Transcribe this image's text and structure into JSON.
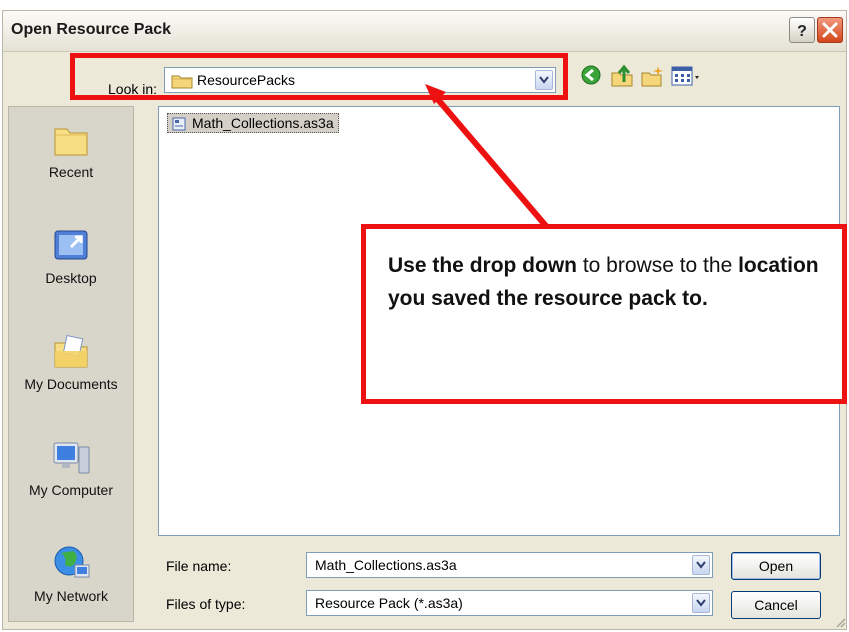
{
  "dialog": {
    "title": "Open Resource Pack",
    "look_in_label": "Look in:",
    "look_in_value": "ResourcePacks",
    "file_name_label": "File name:",
    "file_name_value": "Math_Collections.as3a",
    "files_of_type_label": "Files of type:",
    "files_of_type_value": "Resource Pack (*.as3a)",
    "open_button": "Open",
    "cancel_button": "Cancel"
  },
  "places": [
    {
      "label": "Recent",
      "icon": "recent-folder-icon"
    },
    {
      "label": "Desktop",
      "icon": "desktop-icon"
    },
    {
      "label": "My Documents",
      "icon": "my-documents-icon"
    },
    {
      "label": "My Computer",
      "icon": "my-computer-icon"
    },
    {
      "label": "My Network",
      "icon": "my-network-icon"
    }
  ],
  "files": [
    {
      "name": "Math_Collections.as3a",
      "selected": true
    }
  ],
  "toolbar_icons": [
    "back-icon",
    "up-folder-icon",
    "new-folder-icon",
    "views-menu-icon"
  ],
  "callout": {
    "part1_bold": "Use the drop down",
    "part2": " to browse to the ",
    "part3_bold": "location you saved the resource pack to."
  },
  "colors": {
    "annotation_red": "#ee1111",
    "dialog_bg": "#ece9d8",
    "selection": "#d4d0c8"
  }
}
